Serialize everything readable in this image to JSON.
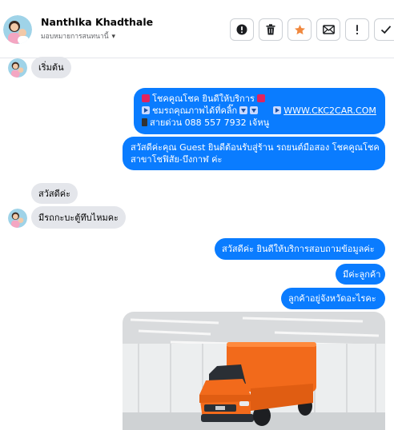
{
  "header": {
    "contact_name": "Nanthlka Khadthale",
    "assign_label": "มอบหมายการสนทนานี้",
    "buttons": [
      {
        "name": "mark-important-button",
        "icon": "exclamation-circle-icon"
      },
      {
        "name": "delete-button",
        "icon": "trash-icon"
      },
      {
        "name": "star-button",
        "icon": "star-icon",
        "color": "#f0883e"
      },
      {
        "name": "move-to-inbox-button",
        "icon": "mail-icon"
      },
      {
        "name": "mark-spam-button",
        "icon": "exclamation-icon"
      },
      {
        "name": "mark-done-button",
        "icon": "check-icon"
      }
    ]
  },
  "messages": [
    {
      "side": "in",
      "text": "เริ่มต้น"
    },
    {
      "side": "out",
      "lines": [
        "โชคคูณโชค ยินดีให้บริการ",
        "ชมรถคุณภาพได้ที่คลิ๊ก",
        "WWW.CKC2CAR.COM",
        "สายด่วน 088 557 7932 เจ้หนู"
      ]
    },
    {
      "side": "out",
      "lines": [
        "สวัสดีค่ะคุณ Guest ยินดีต้อนรับสู่ร้าน รถยนต์มือสอง โชคคูณโชค",
        "สาขาโชฟิสัย-บึงกาฬ ค่ะ"
      ]
    },
    {
      "side": "in",
      "text": "สวัสดีค่ะ"
    },
    {
      "side": "in",
      "text": "มีรถกะบะตู้ทึบไหมคะ"
    },
    {
      "side": "out",
      "text": "สวัสดีค่ะ  ยินดีให้บริการสอบถามข้อมูลค่ะ"
    },
    {
      "side": "out",
      "text": "มีค่ะลูกค้า"
    },
    {
      "side": "out",
      "text": "ลูกค้าอยู่จังหวัดอะไรคะ"
    },
    {
      "side": "out",
      "type": "photo",
      "subject": "orange pickup truck with box body"
    }
  ],
  "colors": {
    "outgoing_bubble": "#0a7cff",
    "incoming_bubble": "#e4e6eb",
    "truck_orange": "#f26a1b"
  }
}
